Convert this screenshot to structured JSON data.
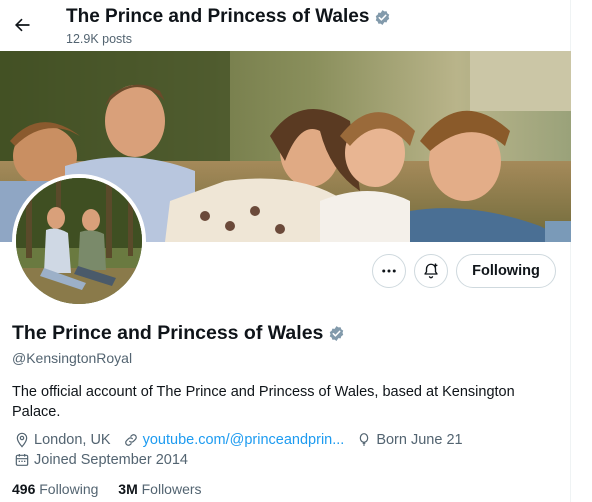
{
  "header": {
    "title": "The Prince and Princess of Wales",
    "posts_count": "12.9K posts",
    "back_icon": "arrow-left-icon",
    "verified_icon": "verified-badge-icon"
  },
  "actions": {
    "more_icon": "more-dots-icon",
    "notify_icon": "bell-plus-icon",
    "following_label": "Following"
  },
  "profile": {
    "name": "The Prince and Princess of Wales",
    "handle": "@KensingtonRoyal",
    "bio": "The official account of The Prince and Princess of Wales, based at Kensington Palace.",
    "location": "London, UK",
    "website": "youtube.com/@princeandprin...",
    "birthday": "Born June 21",
    "joined": "Joined September 2014"
  },
  "stats": {
    "following_count": "496",
    "following_label": "Following",
    "followers_count": "3M",
    "followers_label": "Followers"
  },
  "colors": {
    "accent": "#1d9bf0",
    "text": "#0f1419",
    "muted": "#536471",
    "border": "#cfd9de"
  }
}
